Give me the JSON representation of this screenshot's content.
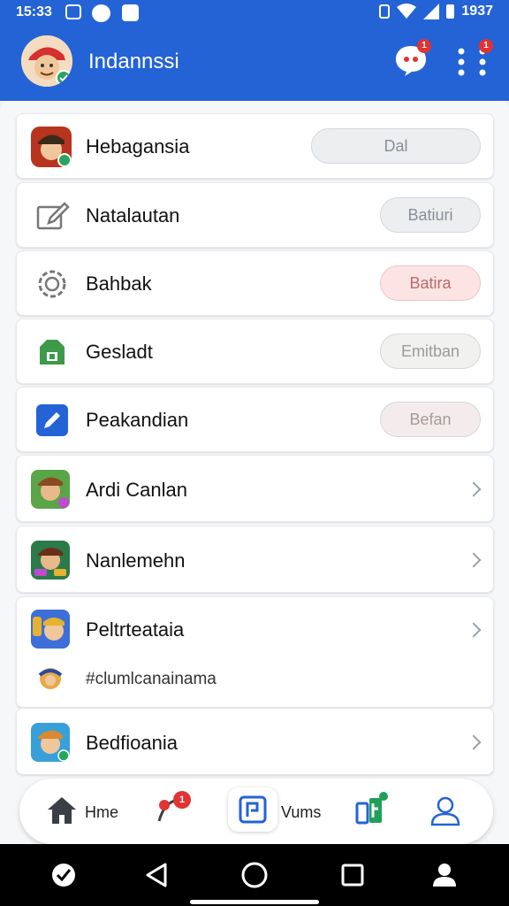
{
  "status_bar": {
    "time": "15:33",
    "battery": "1937"
  },
  "app_bar": {
    "title": "Indannssi",
    "chat_badge": "1",
    "more_badge": "1"
  },
  "colors": {
    "primary": "#2463d6",
    "badge": "#e23232",
    "pill_red": "#fde4e4",
    "pill_grey": "#eceef0"
  },
  "rows": [
    {
      "label": "Hebagansia",
      "button": "Dal",
      "icon": "avatar-icon"
    },
    {
      "label": "Natalautan",
      "button": "Batiuri",
      "icon": "edit-doc-icon"
    },
    {
      "label": "Bahbak",
      "button": "Batira",
      "icon": "gear-ring-icon"
    },
    {
      "label": "Gesladt",
      "button": "Emitban",
      "icon": "green-store-icon"
    },
    {
      "label": "Peakandian",
      "button": "Befan",
      "icon": "pen-icon"
    },
    {
      "label": "Ardi Canlan",
      "icon": "game-character-icon"
    },
    {
      "label": "Nanlemehn",
      "icon": "game-character-icon"
    },
    {
      "label": "Peltrteataia",
      "sub_label": "#clumlcanainama",
      "icon": "game-character-icon"
    },
    {
      "label": "Bedfioania",
      "icon": "game-character-icon"
    }
  ],
  "bottom_nav": {
    "home_label": "Hme",
    "mid_label": "Vums",
    "alerts_badge": "1"
  }
}
